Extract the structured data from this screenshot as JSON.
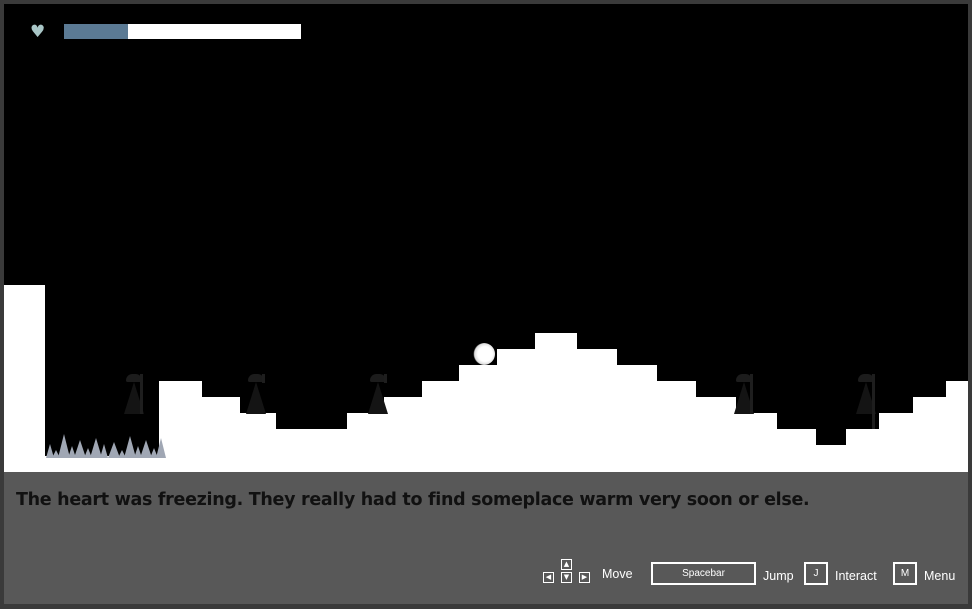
{
  "hud": {
    "heart_icon": "♥",
    "health_fraction": 0.27,
    "health_color": "#5b7a94",
    "heart_color": "#a9c6c7"
  },
  "dialog": {
    "text": "The heart was freezing. They really had to find someplace warm very soon or else."
  },
  "controls": {
    "move_label": "Move",
    "jump_key": "Spacebar",
    "jump_label": "Jump",
    "interact_key": "J",
    "interact_label": "Interact",
    "menu_key": "M",
    "menu_label": "Menu",
    "arrows": {
      "up": "▲",
      "left": "◀",
      "down": "▼",
      "right": "▶"
    }
  },
  "colors": {
    "sky": "#000000",
    "ground": "#ffffff",
    "spikes": "#a0a7b4",
    "panel": "#585858"
  }
}
